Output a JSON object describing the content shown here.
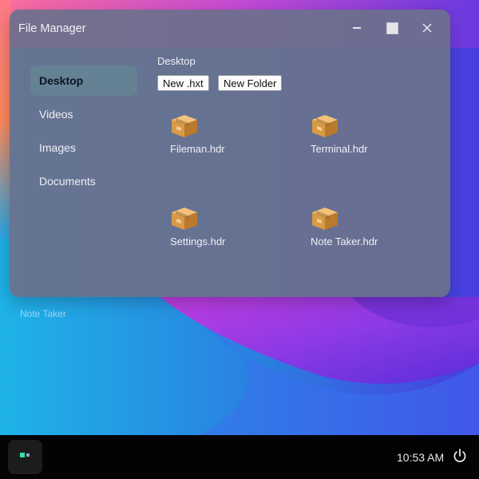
{
  "desktop": {
    "label": "Note Taker"
  },
  "window": {
    "title": "File Manager",
    "controls": {
      "minimize_icon": "minimize-icon",
      "maximize_icon": "maximize-icon",
      "close_icon": "close-icon"
    }
  },
  "sidebar": {
    "items": [
      {
        "label": "Desktop",
        "active": true
      },
      {
        "label": "Videos",
        "active": false
      },
      {
        "label": "Images",
        "active": false
      },
      {
        "label": "Documents",
        "active": false
      }
    ]
  },
  "main": {
    "breadcrumb": "Desktop",
    "buttons": {
      "new_hxt": "New .hxt",
      "new_folder": "New Folder"
    },
    "files": [
      {
        "name": "Fileman.hdr",
        "icon": "package-icon"
      },
      {
        "name": "Terminal.hdr",
        "icon": "package-icon"
      },
      {
        "name": "Settings.hdr",
        "icon": "package-icon"
      },
      {
        "name": "Note Taker.hdr",
        "icon": "package-icon"
      }
    ]
  },
  "taskbar": {
    "time": "10:53 AM",
    "power_icon": "power-icon",
    "launcher_icon": "launcher-icon"
  },
  "colors": {
    "accent_green": "#2fe3a6",
    "window_bg": "#6c708c",
    "taskbar_bg": "#030303"
  }
}
